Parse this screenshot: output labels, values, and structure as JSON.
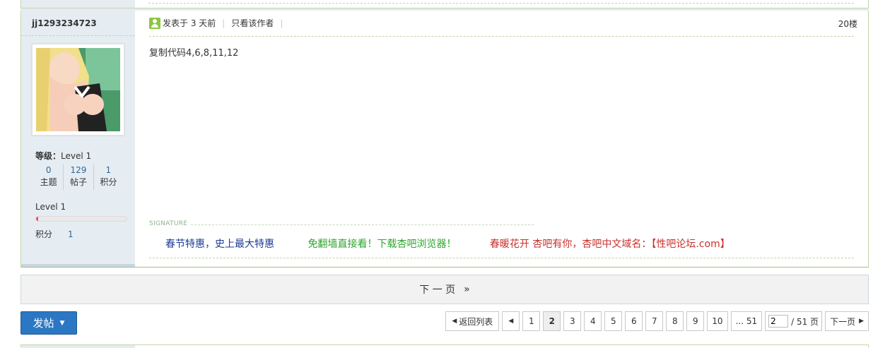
{
  "post": {
    "author": "jj1293234723",
    "posted_text": "发表于 3 天前",
    "only_author": "只看该作者",
    "floor": "20楼",
    "content": "复制代码4,6,8,11,12",
    "level_label": "等级：",
    "level_value": "Level 1",
    "stats": [
      {
        "num": "0",
        "label": "主题"
      },
      {
        "num": "129",
        "label": "帖子"
      },
      {
        "num": "1",
        "label": "积分"
      }
    ],
    "level2": "Level 1",
    "progress_fraction": 0.02,
    "points_label": "积分",
    "points_value": "1",
    "signature_label": "SIGNATURE",
    "signature_links": [
      "春节特惠，史上最大特惠",
      "免翻墙直接看！下载杏吧浏览器！",
      "春暖花开 杏吧有你，杏吧中文域名：【性吧论坛.com】"
    ]
  },
  "next_page": {
    "label": "下 一 页",
    "arrow": "»"
  },
  "post_button": {
    "label": "发帖"
  },
  "pager": {
    "back": "返回列表",
    "pages": [
      "1",
      "2",
      "3",
      "4",
      "5",
      "6",
      "7",
      "8",
      "9",
      "10",
      "... 51"
    ],
    "current": "2",
    "input_value": "2",
    "total": "/ 51 页",
    "next": "下一页"
  },
  "colors": {
    "accent": "#2b77c4",
    "author_bg": "#e5edf2",
    "border": "#c2d5a8"
  }
}
